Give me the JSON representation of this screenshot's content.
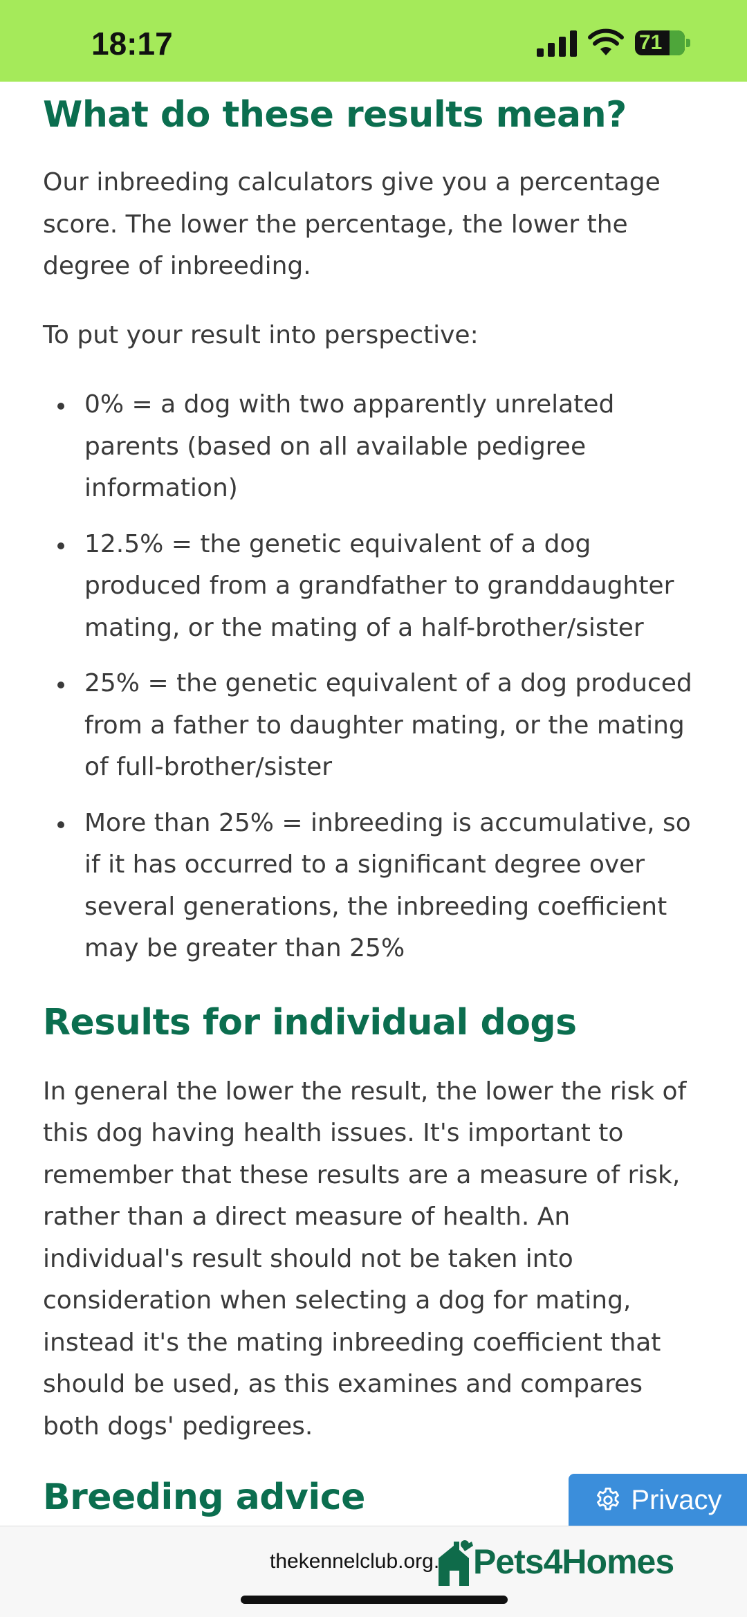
{
  "status_bar": {
    "time": "18:17",
    "battery": "71",
    "icons": [
      "signal-icon",
      "wifi-icon",
      "battery-icon"
    ],
    "background_color": "#a5ea5a"
  },
  "article": {
    "heading_color": "#0b6e4f",
    "section1": {
      "heading": "What do these results mean?",
      "paragraphs": [
        "Our inbreeding calculators give you a percentage score. The lower the percentage, the lower the degree of inbreeding.",
        "To put your result into perspective:"
      ],
      "bullets": [
        "0% = a dog with two apparently unrelated parents (based on all available pedigree information)",
        "12.5% = the genetic equivalent of a dog produced from a grandfather to granddaughter mating, or the mating of a half-brother/sister",
        "25% = the genetic equivalent of a dog produced from a father to daughter mating, or the mating of full-brother/sister",
        "More than 25% = inbreeding is accumulative, so if it has occurred to a significant degree over several generations, the inbreeding coefficient may be greater than 25%"
      ]
    },
    "section2": {
      "heading": "Results for individual dogs",
      "paragraph": "In general the lower the result, the lower the risk of this dog having health issues. It's important to remember that these results are a measure of risk, rather than a direct measure of health. An individual's result should not be taken into consideration when selecting a dog for mating, instead it's the mating inbreeding coefficient that should be used, as this examines and compares both dogs' pedigrees."
    },
    "section3": {
      "heading": "Breeding advice"
    }
  },
  "privacy": {
    "label": "Privacy",
    "icon": "gear-icon",
    "color": "#3b8edb"
  },
  "browser": {
    "url": "thekennelclub.org.uk"
  },
  "watermark": {
    "text": "Pets4Homes",
    "icon": "pets4homes-logo-icon",
    "color": "#0f6b4a"
  }
}
